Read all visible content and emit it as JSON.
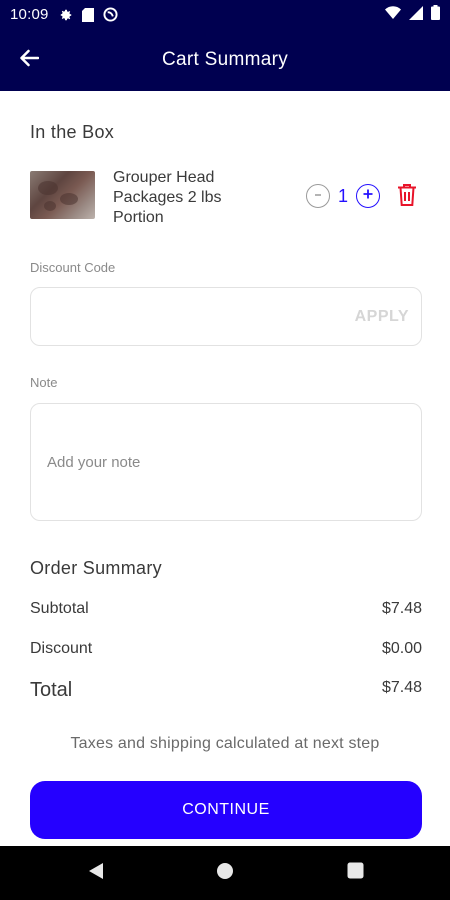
{
  "status_bar": {
    "time": "10:09",
    "icons": [
      "settings-icon",
      "sim-card-icon",
      "no-disturb-icon",
      "wifi-icon",
      "signal-icon",
      "battery-icon"
    ]
  },
  "app_bar": {
    "title": "Cart Summary",
    "back_icon": "arrow-left-icon"
  },
  "box_section": {
    "title": "In the Box"
  },
  "cart_item": {
    "name": "Grouper Head Packages 2 lbs Portion",
    "quantity": "1",
    "minus_icon": "minus-icon",
    "plus_icon": "plus-icon",
    "delete_icon": "trash-icon"
  },
  "discount": {
    "label": "Discount Code",
    "value": "",
    "placeholder": "",
    "apply_label": "APPLY"
  },
  "note": {
    "label": "Note",
    "value": "",
    "placeholder": "Add your note"
  },
  "order_summary": {
    "title": "Order Summary",
    "subtotal_label": "Subtotal",
    "subtotal_value": "$7.48",
    "discount_label": "Discount",
    "discount_value": "$0.00",
    "total_label": "Total",
    "total_value": "$7.48"
  },
  "footer_note": "Taxes and shipping calculated at next step",
  "continue_button": {
    "label": "CONTINUE"
  },
  "colors": {
    "header_bg": "#000050",
    "accent": "#2500ff",
    "delete": "#e8142a"
  },
  "nav_bar": {
    "icons": [
      "back-triangle-icon",
      "home-circle-icon",
      "recents-square-icon"
    ]
  }
}
